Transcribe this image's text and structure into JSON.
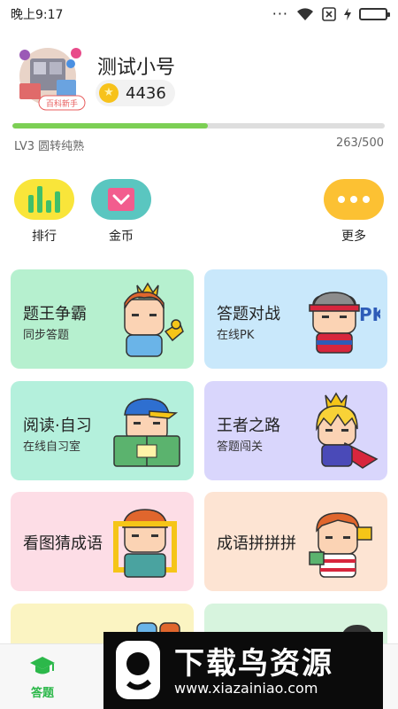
{
  "status_bar": {
    "time": "晚上9:17",
    "icons": [
      "more-dots-icon",
      "wifi-icon",
      "sim-off-icon",
      "charging-bolt-icon",
      "battery-icon"
    ]
  },
  "profile": {
    "avatar_badge": "百科新手",
    "username": "测试小号",
    "coins": "4436",
    "level": "LV3 圆转纯熟",
    "xp": "263/500",
    "xp_progress_fraction": 0.526
  },
  "quick_actions": [
    {
      "label": "排行",
      "icon": "bar-chart-icon",
      "color": "#f9e53a"
    },
    {
      "label": "金币",
      "icon": "coin-box-icon",
      "color": "#5ac6c0"
    },
    {
      "label": "更多",
      "icon": "more-dots-icon",
      "color": "#fcc133"
    }
  ],
  "cards": [
    {
      "title": "题王争霸",
      "subtitle": "同步答题",
      "color": "#b6f0cf",
      "icon": "king-trophy-character-icon"
    },
    {
      "title": "答题对战",
      "subtitle": "在线PK",
      "color": "#c9e8fb",
      "icon": "pk-fighter-character-icon"
    },
    {
      "title": "阅读·自习",
      "subtitle": "在线自习室",
      "color": "#b4f0dc",
      "icon": "reading-book-character-icon"
    },
    {
      "title": "王者之路",
      "subtitle": "答题闯关",
      "color": "#d9d6fc",
      "icon": "crowned-hero-character-icon"
    },
    {
      "title": "看图猜成语",
      "subtitle": "",
      "color": "#fddde6",
      "icon": "picture-frame-character-icon"
    },
    {
      "title": "成语拼拼拼",
      "subtitle": "",
      "color": "#fde4d3",
      "icon": "puzzle-character-icon"
    },
    {
      "title": "",
      "subtitle": "",
      "color": "#fbf4c2",
      "icon": "characters-icon"
    },
    {
      "title": "",
      "subtitle": "",
      "color": "#d7f4de",
      "icon": "character-icon"
    }
  ],
  "bottom_nav": [
    {
      "label": "答题",
      "icon": "graduation-cap-icon",
      "active": true,
      "color": "#2cb84a"
    }
  ],
  "watermark": {
    "title": "下载鸟资源",
    "url": "www.xiazainiao.com"
  }
}
